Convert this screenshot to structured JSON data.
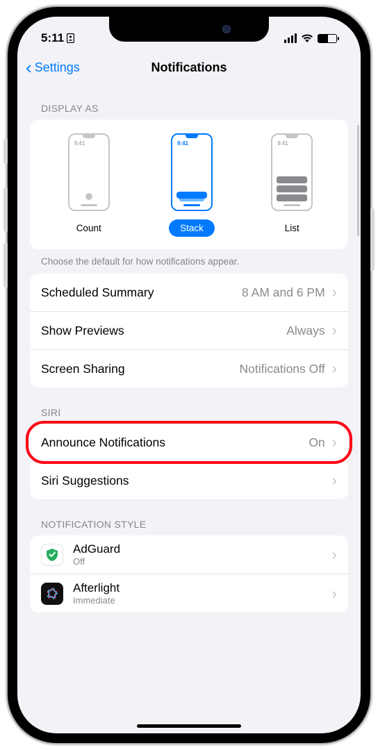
{
  "status": {
    "time": "5:11",
    "contact_badge": true
  },
  "nav": {
    "back_label": "Settings",
    "title": "Notifications"
  },
  "display_as": {
    "header": "DISPLAY AS",
    "mini_time": "9:41",
    "options": {
      "count": "Count",
      "stack": "Stack",
      "list": "List"
    },
    "footer": "Choose the default for how notifications appear."
  },
  "general_rows": {
    "scheduled_summary": {
      "label": "Scheduled Summary",
      "value": "8 AM and 6 PM"
    },
    "show_previews": {
      "label": "Show Previews",
      "value": "Always"
    },
    "screen_sharing": {
      "label": "Screen Sharing",
      "value": "Notifications Off"
    }
  },
  "siri": {
    "header": "SIRI",
    "announce": {
      "label": "Announce Notifications",
      "value": "On"
    },
    "suggestions": {
      "label": "Siri Suggestions"
    }
  },
  "style": {
    "header": "NOTIFICATION STYLE",
    "apps": {
      "adguard": {
        "name": "AdGuard",
        "sub": "Off"
      },
      "afterlight": {
        "name": "Afterlight",
        "sub": "Immediate"
      }
    }
  }
}
